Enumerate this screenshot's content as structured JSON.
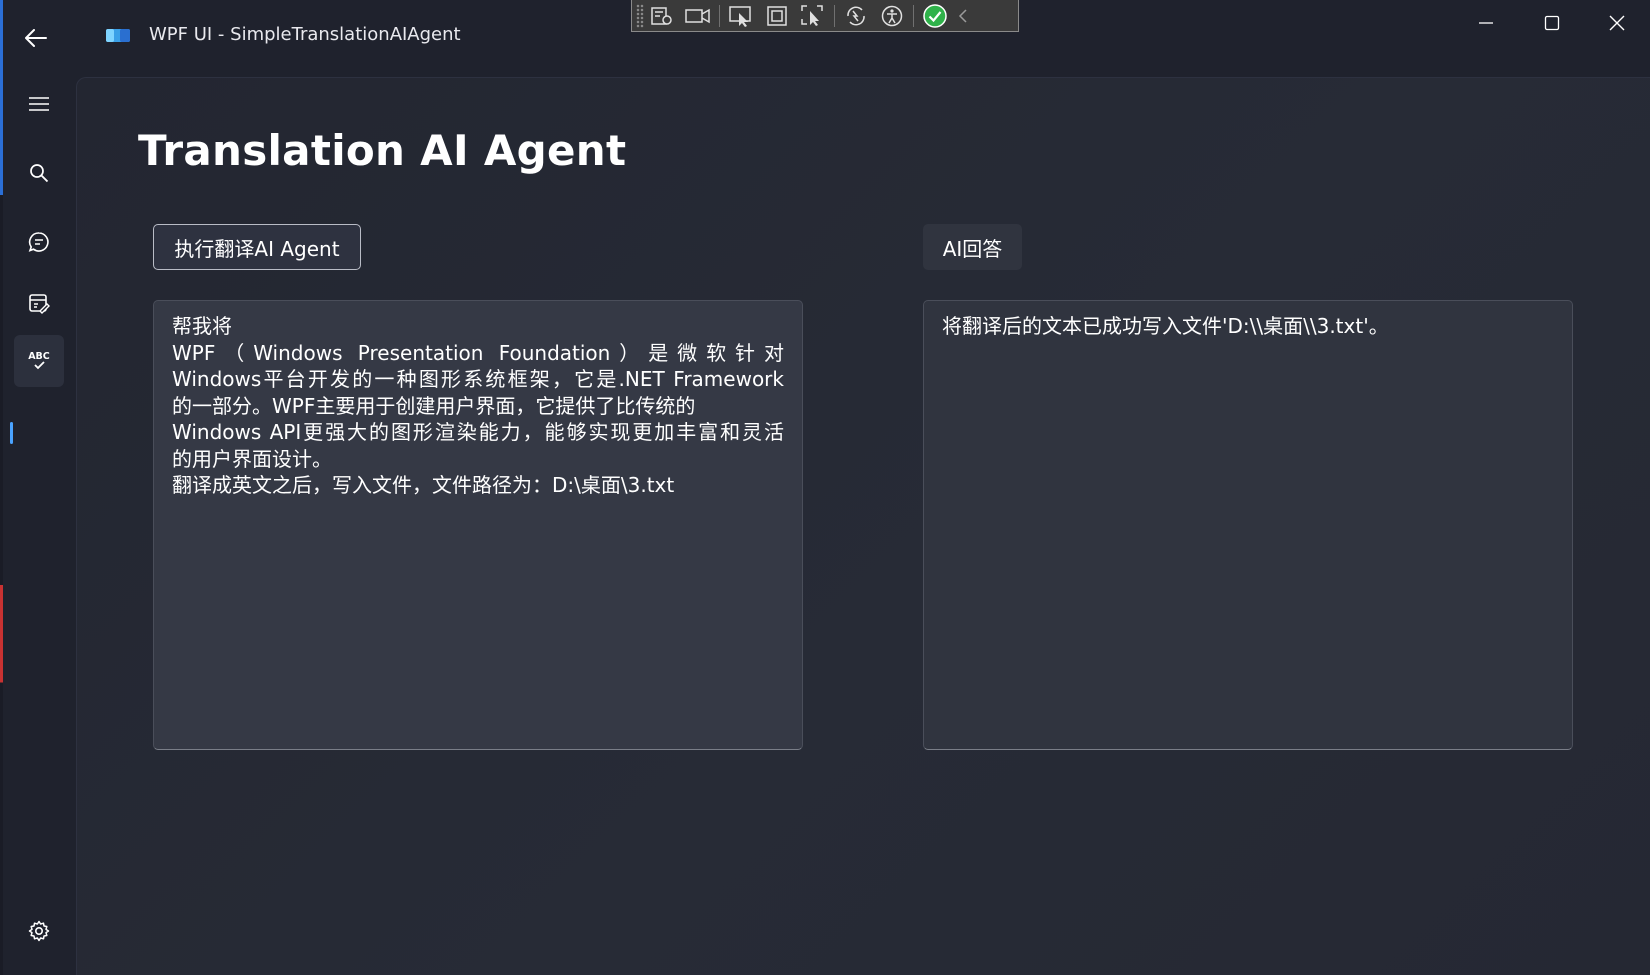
{
  "window": {
    "title": "WPF UI - SimpleTranslationAIAgent"
  },
  "nav": {
    "items": [
      {
        "name": "menu",
        "icon": "hamburger-menu-icon"
      },
      {
        "name": "search",
        "icon": "search-icon"
      },
      {
        "name": "chat",
        "icon": "chat-bubble-icon"
      },
      {
        "name": "forms",
        "icon": "document-edit-icon"
      },
      {
        "name": "spellcheck",
        "icon": "abc-check-icon",
        "label": "ABC",
        "active": true
      }
    ],
    "settings_icon": "gear-icon"
  },
  "page": {
    "title": "Translation AI Agent",
    "run_button": "执行翻译AI Agent",
    "ai_label": "AI回答",
    "input_lines": [
      "帮我将",
      "WPF（Windows Presentation Foundation）是微软针对",
      "Windows平台开发的一种图形系统框架，它是.NET Framework",
      "的一部分。WPF主要用于创建用户界面，它提供了比传统的",
      "Windows API更强大的图形渲染能力，能够实现更加丰富和灵活",
      "的用户界面设计。",
      "翻译成英文之后，写入文件，文件路径为：D:\\桌面\\3.txt"
    ],
    "output_text": "将翻译后的文本已成功写入文件'D:\\\\桌面\\\\3.txt'。"
  },
  "colors": {
    "accent": "#4aa3ff",
    "background": "#1f222d",
    "textbox": "#353945"
  }
}
